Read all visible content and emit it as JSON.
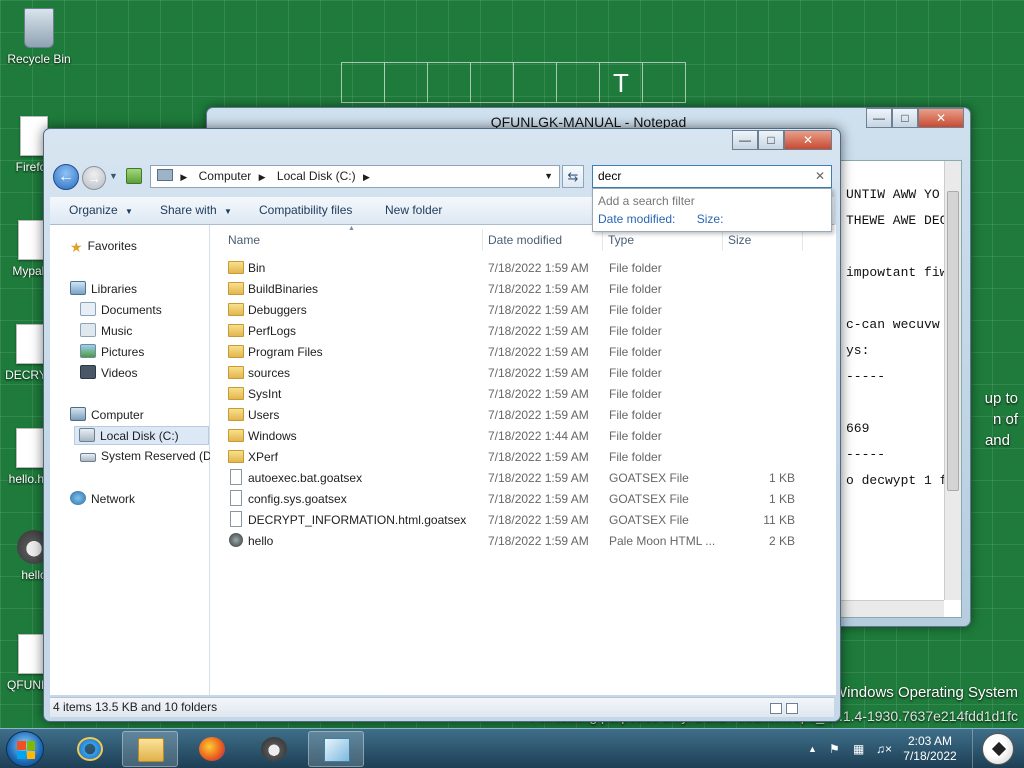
{
  "desktop": {
    "crossword_letter": "T",
    "icons": [
      {
        "name": "recycle-bin",
        "label": "Recycle Bin"
      },
      {
        "name": "firefox",
        "label": "Firefox"
      },
      {
        "name": "mypal",
        "label": "Mypal.r"
      },
      {
        "name": "decrypt",
        "label": "DECRYP"
      },
      {
        "name": "hello-html",
        "label": "hello.htr"
      },
      {
        "name": "hello",
        "label": "hello"
      },
      {
        "name": "qfunlgk",
        "label": "QFUNLG"
      }
    ],
    "watermark": {
      "line1": "up to",
      "line2": "n of",
      "line3": "and",
      "os": "Windows Operating System",
      "build": "For testing purposes only. Build 7601.win7sp1_ldr.1.4-1930.7637e214fdd1d1fc"
    }
  },
  "notepad": {
    "title": "QFUNLGK-MANUAL - Notepad",
    "lines": [
      "UNTIW AWW YO",
      "THEWE AWE DECW",
      "impowtant fiw",
      "c-can wecuvw",
      "ys:",
      "-----",
      "669",
      "-----",
      "o decwypt 1 fi"
    ]
  },
  "explorer": {
    "address": {
      "root": "Computer",
      "current": "Local Disk (C:)"
    },
    "search": {
      "value": "decr",
      "hint": "Add a search filter",
      "filters": [
        "Date modified:",
        "Size:"
      ]
    },
    "toolbar": {
      "organize": "Organize",
      "share": "Share with",
      "compat": "Compatibility files",
      "new_folder": "New folder"
    },
    "nav": {
      "favorites": "Favorites",
      "libraries": "Libraries",
      "documents": "Documents",
      "music": "Music",
      "pictures": "Pictures",
      "videos": "Videos",
      "computer": "Computer",
      "local_disk": "Local Disk (C:)",
      "system_reserved": "System Reserved (D:",
      "network": "Network"
    },
    "columns": {
      "name": "Name",
      "date": "Date modified",
      "type": "Type",
      "size": "Size"
    },
    "rows": [
      {
        "name": "Bin",
        "date": "7/18/2022 1:59 AM",
        "type": "File folder",
        "size": ""
      },
      {
        "name": "BuildBinaries",
        "date": "7/18/2022 1:59 AM",
        "type": "File folder",
        "size": ""
      },
      {
        "name": "Debuggers",
        "date": "7/18/2022 1:59 AM",
        "type": "File folder",
        "size": ""
      },
      {
        "name": "PerfLogs",
        "date": "7/18/2022 1:59 AM",
        "type": "File folder",
        "size": ""
      },
      {
        "name": "Program Files",
        "date": "7/18/2022 1:59 AM",
        "type": "File folder",
        "size": ""
      },
      {
        "name": "sources",
        "date": "7/18/2022 1:59 AM",
        "type": "File folder",
        "size": ""
      },
      {
        "name": "SysInt",
        "date": "7/18/2022 1:59 AM",
        "type": "File folder",
        "size": ""
      },
      {
        "name": "Users",
        "date": "7/18/2022 1:59 AM",
        "type": "File folder",
        "size": ""
      },
      {
        "name": "Windows",
        "date": "7/18/2022 1:44 AM",
        "type": "File folder",
        "size": ""
      },
      {
        "name": "XPerf",
        "date": "7/18/2022 1:59 AM",
        "type": "File folder",
        "size": ""
      },
      {
        "name": "autoexec.bat.goatsex",
        "date": "7/18/2022 1:59 AM",
        "type": "GOATSEX File",
        "size": "1 KB"
      },
      {
        "name": "config.sys.goatsex",
        "date": "7/18/2022 1:59 AM",
        "type": "GOATSEX File",
        "size": "1 KB"
      },
      {
        "name": "DECRYPT_INFORMATION.html.goatsex",
        "date": "7/18/2022 1:59 AM",
        "type": "GOATSEX File",
        "size": "11 KB"
      },
      {
        "name": "hello",
        "date": "7/18/2022 1:59 AM",
        "type": "Pale Moon HTML ...",
        "size": "2 KB"
      }
    ],
    "status": "4 items 13.5 KB and 10 folders"
  },
  "taskbar": {
    "time": "2:03 AM",
    "date": "7/18/2022"
  }
}
